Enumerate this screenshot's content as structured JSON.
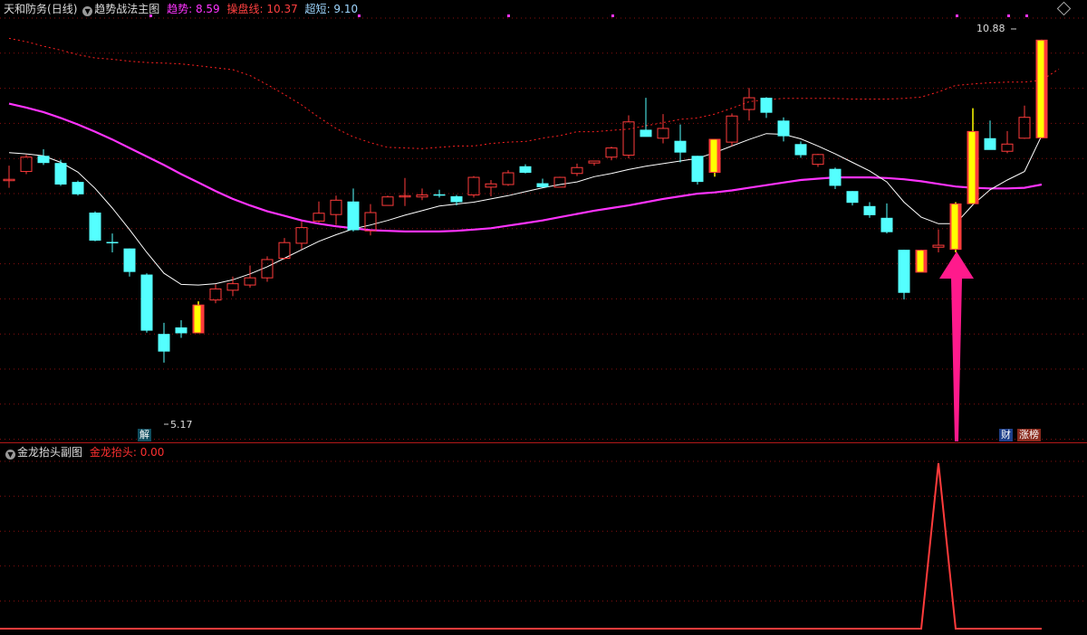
{
  "header": {
    "stock_name": "天和防务",
    "period": "(日线)",
    "indicator_name": "趋势战法主图",
    "trend_label": "趋势",
    "trend_value": "8.59",
    "trader_label": "操盘线",
    "trader_value": "10.37",
    "short_label": "超短",
    "short_value": "9.10"
  },
  "sub_header": {
    "indicator_name": "金龙抬头副图",
    "signal_label": "金龙抬头",
    "signal_value": "0.00"
  },
  "annotations": {
    "high_price": "10.88",
    "low_price": "5.17",
    "low_marker": "解",
    "badge_cai": "财",
    "badge_zhangbang": "涨榜"
  },
  "colors": {
    "up": "#ff3b3b",
    "down": "#54ffff",
    "signal_yellow": "#ffff00",
    "trend_line": "#ff33ff",
    "short_line": "#ffffff",
    "trader_line": "#ff2020",
    "arrow": "#ff1a8c",
    "grid": "#8a1010"
  },
  "chart_data": [
    {
      "type": "candlestick",
      "title": "",
      "ylim": [
        5.0,
        11.1
      ],
      "grid": true,
      "candles": [
        {
          "o": 8.74,
          "h": 8.95,
          "l": 8.61,
          "c": 8.74
        },
        {
          "o": 8.86,
          "h": 9.12,
          "l": 8.82,
          "c": 9.08
        },
        {
          "o": 9.1,
          "h": 9.2,
          "l": 8.96,
          "c": 8.99
        },
        {
          "o": 8.99,
          "h": 9.04,
          "l": 8.64,
          "c": 8.66
        },
        {
          "o": 8.7,
          "h": 8.72,
          "l": 8.49,
          "c": 8.51
        },
        {
          "o": 8.23,
          "h": 8.25,
          "l": 7.79,
          "c": 7.8
        },
        {
          "o": 7.78,
          "h": 7.91,
          "l": 7.62,
          "c": 7.76
        },
        {
          "o": 7.68,
          "h": 7.68,
          "l": 7.25,
          "c": 7.32
        },
        {
          "o": 7.28,
          "h": 7.3,
          "l": 6.39,
          "c": 6.42
        },
        {
          "o": 6.37,
          "h": 6.54,
          "l": 5.93,
          "c": 6.1
        },
        {
          "o": 6.47,
          "h": 6.58,
          "l": 6.31,
          "c": 6.38
        },
        {
          "o": 6.38,
          "h": 6.87,
          "l": 6.38,
          "c": 6.82,
          "signal": true
        },
        {
          "o": 6.89,
          "h": 7.13,
          "l": 6.84,
          "c": 7.06
        },
        {
          "o": 7.04,
          "h": 7.25,
          "l": 6.95,
          "c": 7.14
        },
        {
          "o": 7.12,
          "h": 7.42,
          "l": 7.08,
          "c": 7.23
        },
        {
          "o": 7.23,
          "h": 7.56,
          "l": 7.17,
          "c": 7.51
        },
        {
          "o": 7.53,
          "h": 7.84,
          "l": 7.51,
          "c": 7.77
        },
        {
          "o": 7.76,
          "h": 8.09,
          "l": 7.67,
          "c": 8.0
        },
        {
          "o": 8.1,
          "h": 8.4,
          "l": 8.08,
          "c": 8.22
        },
        {
          "o": 8.2,
          "h": 8.49,
          "l": 8.04,
          "c": 8.42
        },
        {
          "o": 8.4,
          "h": 8.6,
          "l": 7.94,
          "c": 7.96
        },
        {
          "o": 7.95,
          "h": 8.36,
          "l": 7.88,
          "c": 8.23
        },
        {
          "o": 8.34,
          "h": 8.49,
          "l": 8.34,
          "c": 8.47
        },
        {
          "o": 8.49,
          "h": 8.76,
          "l": 8.33,
          "c": 8.49
        },
        {
          "o": 8.47,
          "h": 8.6,
          "l": 8.42,
          "c": 8.5
        },
        {
          "o": 8.51,
          "h": 8.58,
          "l": 8.46,
          "c": 8.5
        },
        {
          "o": 8.48,
          "h": 8.5,
          "l": 8.34,
          "c": 8.39
        },
        {
          "o": 8.5,
          "h": 8.79,
          "l": 8.46,
          "c": 8.77
        },
        {
          "o": 8.62,
          "h": 8.73,
          "l": 8.48,
          "c": 8.67
        },
        {
          "o": 8.66,
          "h": 8.88,
          "l": 8.64,
          "c": 8.84
        },
        {
          "o": 8.94,
          "h": 8.97,
          "l": 8.83,
          "c": 8.84
        },
        {
          "o": 8.68,
          "h": 8.75,
          "l": 8.61,
          "c": 8.62
        },
        {
          "o": 8.62,
          "h": 8.78,
          "l": 8.62,
          "c": 8.77
        },
        {
          "o": 8.83,
          "h": 8.98,
          "l": 8.79,
          "c": 8.92
        },
        {
          "o": 8.99,
          "h": 9.02,
          "l": 8.95,
          "c": 9.02
        },
        {
          "o": 9.08,
          "h": 9.24,
          "l": 9.03,
          "c": 9.22
        },
        {
          "o": 9.11,
          "h": 9.72,
          "l": 9.06,
          "c": 9.62
        },
        {
          "o": 9.5,
          "h": 9.99,
          "l": 9.45,
          "c": 9.39
        },
        {
          "o": 9.37,
          "h": 9.74,
          "l": 9.29,
          "c": 9.52
        },
        {
          "o": 9.33,
          "h": 9.58,
          "l": 9.0,
          "c": 9.15
        },
        {
          "o": 9.1,
          "h": 9.1,
          "l": 8.66,
          "c": 8.7
        },
        {
          "o": 8.84,
          "h": 9.36,
          "l": 8.78,
          "c": 9.36,
          "signal": true
        },
        {
          "o": 9.31,
          "h": 9.75,
          "l": 9.25,
          "c": 9.71
        },
        {
          "o": 9.81,
          "h": 10.14,
          "l": 9.64,
          "c": 9.99
        },
        {
          "o": 9.99,
          "h": 10.0,
          "l": 9.68,
          "c": 9.76
        },
        {
          "o": 9.64,
          "h": 9.69,
          "l": 9.32,
          "c": 9.4
        },
        {
          "o": 9.28,
          "h": 9.32,
          "l": 9.07,
          "c": 9.11
        },
        {
          "o": 8.97,
          "h": 9.13,
          "l": 8.93,
          "c": 9.12
        },
        {
          "o": 8.9,
          "h": 8.92,
          "l": 8.59,
          "c": 8.64
        },
        {
          "o": 8.56,
          "h": 8.56,
          "l": 8.34,
          "c": 8.38
        },
        {
          "o": 8.33,
          "h": 8.39,
          "l": 8.15,
          "c": 8.19
        },
        {
          "o": 8.15,
          "h": 8.37,
          "l": 7.91,
          "c": 7.93
        },
        {
          "o": 7.66,
          "h": 7.66,
          "l": 6.9,
          "c": 7.0
        },
        {
          "o": 7.31,
          "h": 7.66,
          "l": 7.34,
          "c": 7.66,
          "signal": true
        },
        {
          "o": 7.7,
          "h": 7.97,
          "l": 7.62,
          "c": 7.73
        },
        {
          "o": 7.66,
          "h": 8.39,
          "l": 7.62,
          "c": 8.37,
          "signal": true
        },
        {
          "o": 8.36,
          "h": 9.83,
          "l": 8.36,
          "c": 9.48,
          "signal": true
        },
        {
          "o": 9.37,
          "h": 9.64,
          "l": 9.27,
          "c": 9.19
        },
        {
          "o": 9.17,
          "h": 9.48,
          "l": 9.14,
          "c": 9.28
        },
        {
          "o": 9.37,
          "h": 9.87,
          "l": 9.36,
          "c": 9.69
        },
        {
          "o": 9.37,
          "h": 10.88,
          "l": 9.37,
          "c": 10.88,
          "signal": true
        }
      ],
      "trend_line": [
        9.9,
        9.84,
        9.77,
        9.68,
        9.58,
        9.47,
        9.35,
        9.22,
        9.09,
        8.96,
        8.82,
        8.69,
        8.56,
        8.44,
        8.34,
        8.25,
        8.18,
        8.11,
        8.06,
        8.02,
        7.99,
        7.96,
        7.95,
        7.94,
        7.94,
        7.94,
        7.95,
        7.97,
        7.99,
        8.03,
        8.07,
        8.11,
        8.16,
        8.21,
        8.26,
        8.3,
        8.34,
        8.39,
        8.44,
        8.48,
        8.52,
        8.54,
        8.57,
        8.61,
        8.65,
        8.69,
        8.73,
        8.75,
        8.77,
        8.77,
        8.77,
        8.76,
        8.74,
        8.71,
        8.67,
        8.63,
        8.61,
        8.6,
        8.6,
        8.61,
        8.66
      ],
      "short_line": [
        9.15,
        9.13,
        9.1,
        9.0,
        8.85,
        8.6,
        8.3,
        7.97,
        7.62,
        7.3,
        7.13,
        7.12,
        7.14,
        7.2,
        7.29,
        7.4,
        7.53,
        7.66,
        7.79,
        7.89,
        7.98,
        8.04,
        8.11,
        8.19,
        8.26,
        8.33,
        8.36,
        8.39,
        8.44,
        8.49,
        8.55,
        8.61,
        8.66,
        8.7,
        8.78,
        8.83,
        8.89,
        8.94,
        8.98,
        9.02,
        9.06,
        9.15,
        9.25,
        9.35,
        9.44,
        9.43,
        9.36,
        9.25,
        9.13,
        9.0,
        8.87,
        8.7,
        8.39,
        8.16,
        8.06,
        8.06,
        8.35,
        8.58,
        8.73,
        8.86,
        9.41
      ],
      "trader_line": [
        10.9,
        10.85,
        10.78,
        10.72,
        10.65,
        10.6,
        10.58,
        10.55,
        10.53,
        10.52,
        10.51,
        10.48,
        10.45,
        10.42,
        10.33,
        10.19,
        10.04,
        9.88,
        9.69,
        9.52,
        9.39,
        9.3,
        9.23,
        9.22,
        9.21,
        9.23,
        9.25,
        9.25,
        9.29,
        9.31,
        9.32,
        9.37,
        9.41,
        9.47,
        9.47,
        9.49,
        9.51,
        9.56,
        9.61,
        9.66,
        9.68,
        9.74,
        9.83,
        9.93,
        9.96,
        9.98,
        9.98,
        9.98,
        9.98,
        9.97,
        9.97,
        9.97,
        9.98,
        10.0,
        10.08,
        10.18,
        10.2,
        10.22,
        10.23,
        10.23,
        10.26,
        10.43
      ]
    },
    {
      "type": "line",
      "title": "",
      "ylim": [
        0,
        1
      ],
      "grid": true,
      "values": [
        0,
        0,
        0,
        0,
        0,
        0,
        0,
        0,
        0,
        0,
        0,
        0,
        0,
        0,
        0,
        0,
        0,
        0,
        0,
        0,
        0,
        0,
        0,
        0,
        0,
        0,
        0,
        0,
        0,
        0,
        0,
        0,
        0,
        0,
        0,
        0,
        0,
        0,
        0,
        0,
        0,
        0,
        0,
        0,
        0,
        0,
        0,
        0,
        0,
        0,
        0,
        0,
        0,
        0,
        0,
        0,
        1,
        0,
        0,
        0,
        0,
        0,
        0
      ]
    }
  ]
}
